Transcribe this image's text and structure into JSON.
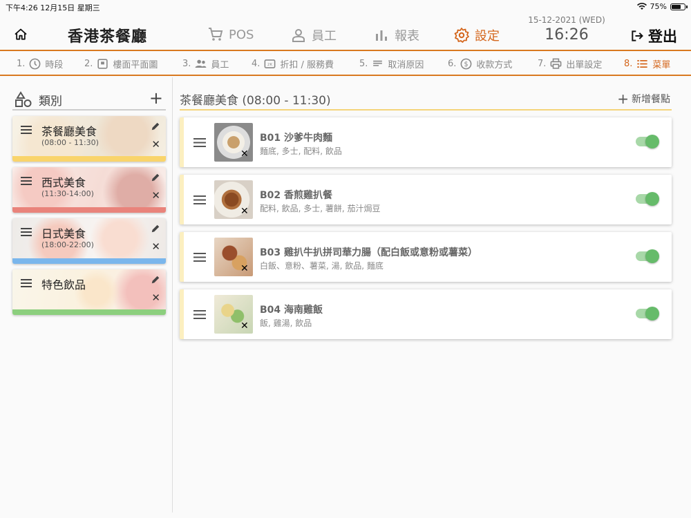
{
  "status_bar": {
    "left": "下午4:26  12月15日 星期三",
    "battery": "75%",
    "battery_level": 0.75
  },
  "header": {
    "app_title": "香港茶餐廳",
    "nav": [
      {
        "label": "POS",
        "icon": "cart-icon"
      },
      {
        "label": "員工",
        "icon": "person-icon"
      },
      {
        "label": "報表",
        "icon": "bar-chart-icon"
      },
      {
        "label": "設定",
        "icon": "gear-icon",
        "active": true
      }
    ],
    "date": "15-12-2021 (WED)",
    "time": "16:26",
    "logout": "登出"
  },
  "steps": [
    {
      "num": "1.",
      "label": "時段",
      "icon": "clock-icon"
    },
    {
      "num": "2.",
      "label": "樓面平面圖",
      "icon": "floor-plan-icon"
    },
    {
      "num": "3.",
      "label": "員工",
      "icon": "people-icon"
    },
    {
      "num": "4.",
      "label": "折扣 / 服務費",
      "icon": "discount-icon"
    },
    {
      "num": "5.",
      "label": "取消原因",
      "icon": "notes-icon"
    },
    {
      "num": "6.",
      "label": "收款方式",
      "icon": "dollar-icon"
    },
    {
      "num": "7.",
      "label": "出單設定",
      "icon": "printer-icon"
    },
    {
      "num": "8.",
      "label": "菜單",
      "icon": "list-icon",
      "active": true
    }
  ],
  "categories_panel": {
    "title": "類別",
    "items": [
      {
        "name": "茶餐廳美食",
        "time": "(08:00 - 11:30)",
        "color": "#f9d46b"
      },
      {
        "name": "西式美食",
        "time": "(11:30-14:00)",
        "color": "#e9837b"
      },
      {
        "name": "日式美食",
        "time": "(18:00-22:00)",
        "color": "#7ab6ec"
      },
      {
        "name": "特色飲品",
        "time": "",
        "color": "#8ccf7e"
      }
    ]
  },
  "menu_panel": {
    "title": "茶餐廳美食 (08:00 - 11:30)",
    "add_label": "新增餐點",
    "items": [
      {
        "name": "B01 沙爹牛肉麵",
        "desc": "麵底, 多士, 配料, 飲品",
        "enabled": true
      },
      {
        "name": "B02 香煎雞扒餐",
        "desc": "配料, 飲品, 多士, 薯餅, 茄汁焗豆",
        "enabled": true
      },
      {
        "name": "B03 雞扒牛扒拼司華力腸（配白飯或意粉或薯菜）",
        "desc": "白飯、意粉、薯菜, 湯, 飲品, 麵底",
        "enabled": true
      },
      {
        "name": "B04 海南雞飯",
        "desc": "飯, 雞湯, 飲品",
        "enabled": true
      }
    ]
  }
}
